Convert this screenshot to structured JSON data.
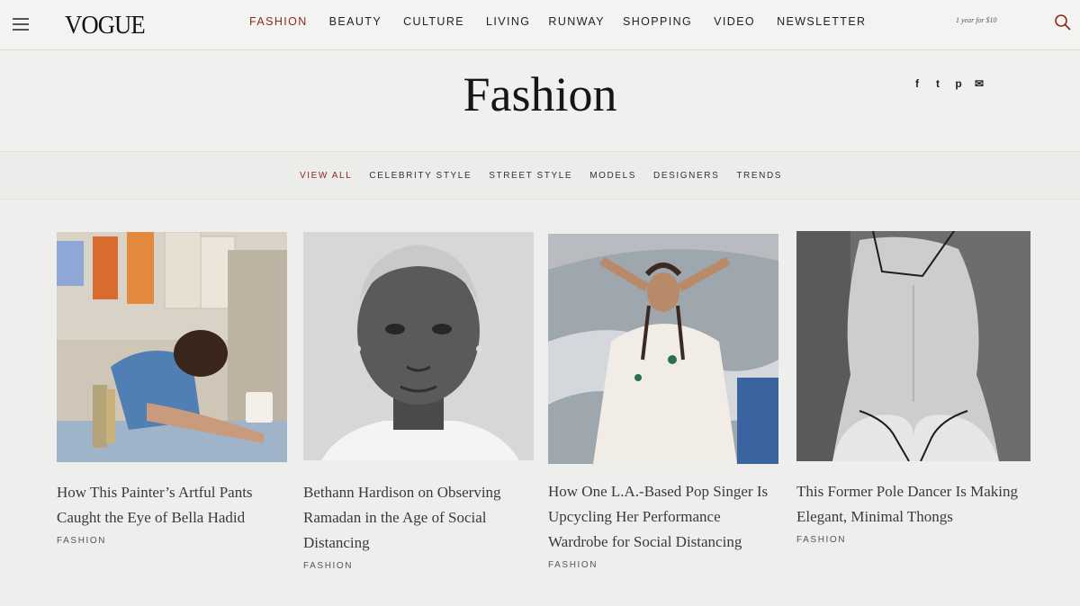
{
  "header": {
    "logo": "VOGUE",
    "nav": [
      {
        "label": "FASHION",
        "active": true
      },
      {
        "label": "BEAUTY"
      },
      {
        "label": "CULTURE"
      },
      {
        "label": "LIVING"
      },
      {
        "label": "RUNWAY"
      },
      {
        "label": "SHOPPING"
      },
      {
        "label": "VIDEO"
      },
      {
        "label": "NEWSLETTER"
      }
    ],
    "promo": "1 year for $10",
    "menu_icon": "hamburger-menu-icon",
    "search_icon": "search-icon"
  },
  "page": {
    "title": "Fashion",
    "social": [
      {
        "label": "f",
        "icon": "facebook-icon"
      },
      {
        "label": "t",
        "icon": "twitter-icon"
      },
      {
        "label": "p",
        "icon": "pinterest-icon"
      },
      {
        "label": "✉",
        "icon": "email-icon"
      }
    ]
  },
  "subnav": [
    {
      "label": "VIEW ALL",
      "active": true
    },
    {
      "label": "CELEBRITY STYLE"
    },
    {
      "label": "STREET STYLE"
    },
    {
      "label": "MODELS"
    },
    {
      "label": "DESIGNERS"
    },
    {
      "label": "TRENDS"
    }
  ],
  "cards": [
    {
      "title": "How This Painter’s Artful Pants Caught the Eye of Bella Hadid",
      "tag": "FASHION"
    },
    {
      "title": "Bethann Hardison on Observing Ramadan in the Age of Social Distancing",
      "tag": "FASHION"
    },
    {
      "title": "How One L.A.-Based Pop Singer Is Upcycling Her Performance Wardrobe for Social Distancing",
      "tag": "FASHION"
    },
    {
      "title": "This Former Pole Dancer Is Making Elegant, Minimal Thongs",
      "tag": "FASHION"
    }
  ],
  "colors": {
    "accent": "#8b2a1c",
    "background": "#eeeeec"
  }
}
